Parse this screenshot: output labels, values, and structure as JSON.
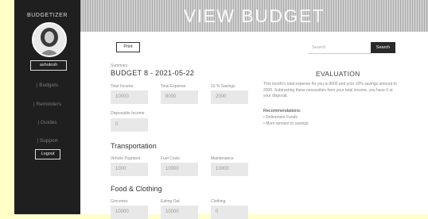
{
  "sidebar": {
    "brand": "BUDGETIZER",
    "username": "ashutosh",
    "nav": [
      "| Budgets",
      "| Reminders",
      "| Guides",
      "| Support"
    ],
    "logout_label": "Logout"
  },
  "header": {
    "title": "VIEW BUDGET"
  },
  "toolbar": {
    "print_label": "Print",
    "search_placeholder": "Search",
    "search_label": "Search"
  },
  "budget": {
    "summary_label": "Summary",
    "title": "BUDGET 8 - 2021-05-22",
    "fields": [
      {
        "label": "Total Income",
        "value": "10000"
      },
      {
        "label": "Total Expense",
        "value": "8000"
      },
      {
        "label": "10 % Savings",
        "value": "2000"
      }
    ],
    "disposable": {
      "label": "Disposable Income",
      "value": "0"
    }
  },
  "sections": [
    {
      "title": "Transportation",
      "fields": [
        {
          "label": "Vehicle Payment",
          "value": "1000"
        },
        {
          "label": "Fuel Costs",
          "value": "10000"
        },
        {
          "label": "Maintenance",
          "value": "10000"
        }
      ]
    },
    {
      "title": "Food & Clothing",
      "fields": [
        {
          "label": "Groceries",
          "value": "10000"
        },
        {
          "label": "Eating Out",
          "value": "10000"
        },
        {
          "label": "Clothing",
          "value": "0"
        }
      ]
    }
  ],
  "evaluation": {
    "title": "EVALUATION",
    "text": "This month's total expense for you is 8000 and your 10% savings amount to 2000. Subtracting these necessities from your total income, you have 0 at your disposal.",
    "rec_title": "Recommendations:",
    "recommendations": [
      "• Retirement Funds",
      "• More amount to savings"
    ]
  }
}
